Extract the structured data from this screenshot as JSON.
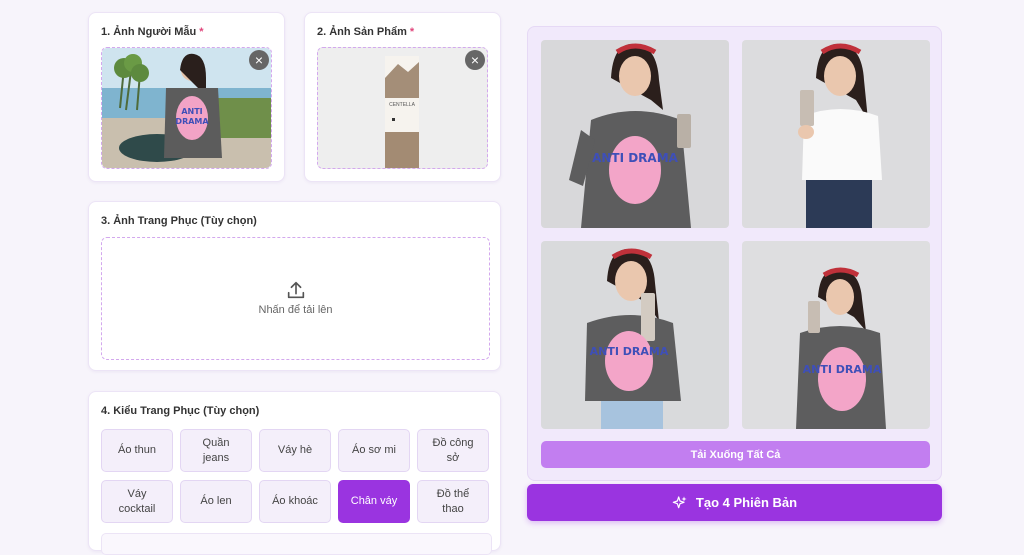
{
  "model_photo": {
    "label": "1. Ảnh Người Mẫu",
    "required_mark": "*",
    "remove_icon": "close-icon"
  },
  "product_photo": {
    "label": "2. Ảnh Sản Phẩm",
    "required_mark": "*",
    "remove_icon": "close-icon",
    "product_label": "CENTELLA"
  },
  "outfit_photo": {
    "label": "3. Ảnh Trang Phục (Tùy chọn)",
    "upload_icon": "upload-icon",
    "upload_text": "Nhấn để tải lên"
  },
  "outfit_style": {
    "label": "4. Kiểu Trang Phục (Tùy chọn)",
    "options": [
      {
        "label": "Áo thun",
        "active": false
      },
      {
        "label": "Quần jeans",
        "active": false
      },
      {
        "label": "Váy hè",
        "active": false
      },
      {
        "label": "Áo sơ mi",
        "active": false
      },
      {
        "label": "Đồ công sở",
        "active": false
      },
      {
        "label": "Váy cocktail",
        "active": false
      },
      {
        "label": "Áo len",
        "active": false
      },
      {
        "label": "Áo khoác",
        "active": false
      },
      {
        "label": "Chân váy",
        "active": true
      },
      {
        "label": "Đồ thể thao",
        "active": false
      }
    ]
  },
  "results": {
    "shirt_text": "ANTI DRAMA",
    "download_all_label": "Tải Xuống Tất Cả"
  },
  "generate": {
    "label": "Tạo 4 Phiên Bản",
    "icon": "sparkles-icon"
  },
  "colors": {
    "accent": "#9a34e0",
    "accent_light": "#c27ef0",
    "panel_bg": "#f1e9fb"
  }
}
